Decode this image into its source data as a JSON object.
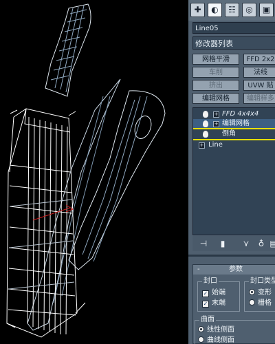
{
  "toolbar": {
    "icons": [
      "create-icon",
      "modify-icon",
      "hierarchy-icon",
      "motion-icon",
      "display-icon"
    ]
  },
  "object_name": "Line05",
  "modifier_list": "修改器列表",
  "quick_buttons": {
    "mesh_smooth": "网格平滑",
    "ffd": "FFD 2x2",
    "lathe": "车削",
    "normal": "法线",
    "extrude": "挤出",
    "uvw": "UVW 贴",
    "edit_mesh": "编辑网格",
    "edit_poly": "编辑样多"
  },
  "stack": {
    "items": [
      {
        "label": "FFD 4x4x4",
        "state": "active-italic"
      },
      {
        "label": "编辑网格",
        "state": "highlighted"
      },
      {
        "label": "倒角",
        "state": "selected"
      },
      {
        "label": "Line",
        "state": "base"
      }
    ]
  },
  "mod_tools": [
    "pin-stack-icon",
    "show-end-result-icon",
    "make-unique-icon",
    "remove-modifier-icon",
    "configure-sets-icon"
  ],
  "params": {
    "title": "参数",
    "collapse_sign": "-",
    "caps_group": "封口",
    "start": "始端",
    "end": "末端",
    "cap_type_group": "封口类型",
    "morph": "变形",
    "grid": "栅格",
    "surface_group": "曲面",
    "linear_sides": "线性侧面",
    "curved_sides": "曲线侧面"
  },
  "colors": {
    "panel_bg": "#4f5f6f",
    "stack_bg": "#314355",
    "highlight_row": "#3d5f83",
    "selection_line": "#e8e000",
    "wire_main": "#ffffff",
    "wire_secondary": "#8fa8c0",
    "gizmo_red": "#d02020"
  }
}
